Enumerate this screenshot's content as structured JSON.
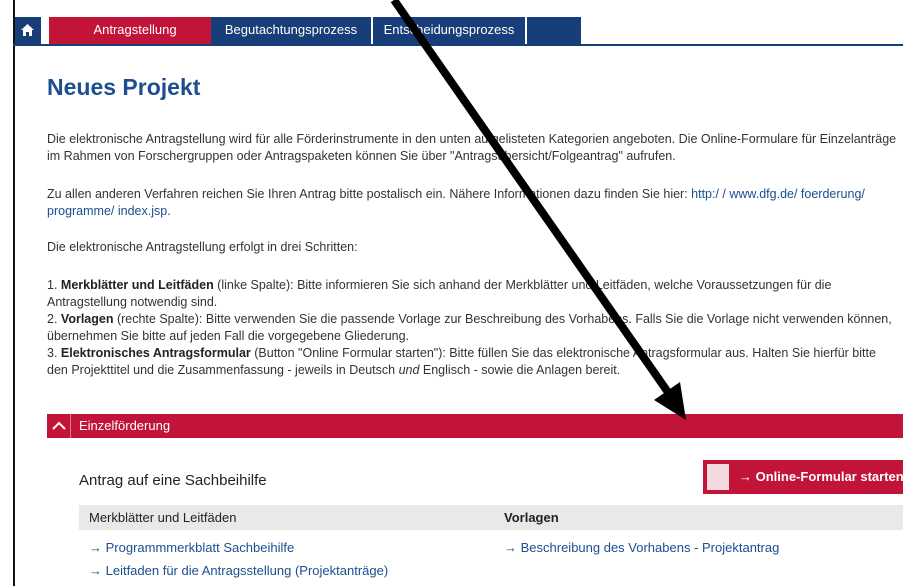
{
  "nav": {
    "home_icon": "home-icon",
    "tabs": [
      {
        "label": "Antragstellung",
        "active": true
      },
      {
        "label": "Begutachtungsprozess",
        "active": false
      },
      {
        "label": "Entscheidungsprozess",
        "active": false
      },
      {
        "label": "",
        "active": false
      }
    ]
  },
  "page": {
    "title": "Neues Projekt",
    "intro_1": "Die elektronische Antragstellung wird für alle Förderinstrumente in den unten aufgelisteten Kategorien angeboten. Die Online-Formulare für Einzelanträge im Rahmen von Forschergruppen oder Antragspaketen können Sie über \"Antragsübersicht/Folgeantrag\" aufrufen.",
    "intro_2_text": "Zu allen anderen Verfahren reichen Sie Ihren Antrag bitte postalisch ein. Nähere Informationen dazu finden Sie hier: ",
    "intro_2_link": "http:/ / www.dfg.de/ foerderung/ programme/ index.jsp",
    "intro_2_end": ".",
    "intro_3": "Die elektronische Antragstellung erfolgt in drei Schritten:",
    "steps": [
      {
        "num": "1. ",
        "bold": "Merkblätter und Leitfäden",
        "text": " (linke Spalte): Bitte informieren Sie sich anhand der Merkblätter und Leitfäden, welche Voraussetzungen für die Antragstellung notwendig sind."
      },
      {
        "num": "2. ",
        "bold": "Vorlagen",
        "text": " (rechte Spalte): Bitte verwenden Sie die passende Vorlage zur Beschreibung des Vorhabens. Falls Sie die Vorlage nicht verwenden können, übernehmen Sie bitte auf jeden Fall die vorgegebene Gliederung."
      },
      {
        "num": "3. ",
        "bold": "Elektronisches Antragsformular",
        "text_a": " (Button \"Online Formular starten\"): Bitte füllen Sie das elektronische Antragsformular aus. Halten Sie hierfür bitte den Projekttitel und die Zusammenfassung - jeweils in Deutsch ",
        "italic": "und",
        "text_b": " Englisch - sowie die Anlagen bereit."
      }
    ]
  },
  "section": {
    "label": "Einzelförderung",
    "toggle_icon": "chevron-up-icon",
    "project_title": "Antrag auf eine Sachbeihilfe",
    "online_button": "→ Online-Formular starten",
    "col_left": "Merkblätter und Leitfäden",
    "col_right": "Vorlagen",
    "links_left": [
      "→ Programmmerkblatt Sachbeihilfe",
      "→ Leitfaden für die Antragsstellung (Projektanträge)"
    ],
    "links_right": [
      "→ Beschreibung des Vorhabens - Projektantrag"
    ]
  },
  "annotation": {
    "arrow_icon": "annotation-arrow-icon",
    "color": "#000000"
  },
  "colors": {
    "brand_red": "#c11438",
    "brand_blue": "#173e78",
    "title_blue": "#1b4f8f"
  }
}
